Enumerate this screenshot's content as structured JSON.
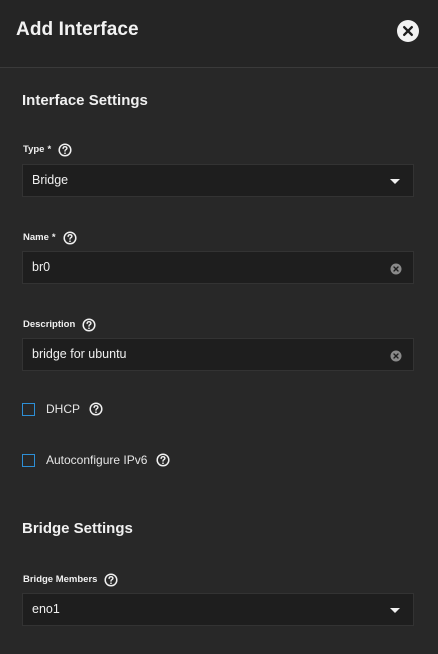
{
  "dialog": {
    "title": "Add Interface",
    "close_icon": "close-icon"
  },
  "interface_settings": {
    "heading": "Interface Settings",
    "type": {
      "label": "Type",
      "required_mark": "*",
      "value": "Bridge"
    },
    "name": {
      "label": "Name",
      "required_mark": "*",
      "value": "br0"
    },
    "description": {
      "label": "Description",
      "value": "bridge for ubuntu"
    },
    "dhcp": {
      "label": "DHCP",
      "checked": false
    },
    "autoconfigure_ipv6": {
      "label": "Autoconfigure IPv6",
      "checked": false
    }
  },
  "bridge_settings": {
    "heading": "Bridge Settings",
    "bridge_members": {
      "label": "Bridge Members",
      "value": "eno1"
    }
  },
  "colors": {
    "background": "#282828",
    "input_background": "#1e1e1e",
    "checkbox_accent": "#2d8fd6",
    "text": "#f0f0f0"
  }
}
